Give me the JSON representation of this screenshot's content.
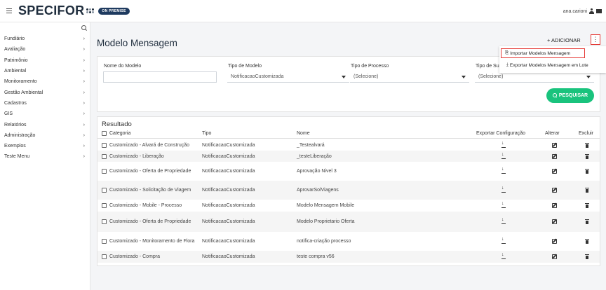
{
  "header": {
    "brand": "SPECIFOR",
    "badge": "ON PREMISE",
    "user": "ana.carioni"
  },
  "sidebar": {
    "items": [
      {
        "label": "Fundiário"
      },
      {
        "label": "Avaliação"
      },
      {
        "label": "Patrimônio"
      },
      {
        "label": "Ambiental"
      },
      {
        "label": "Monitoramento"
      },
      {
        "label": "Gestão Ambiental"
      },
      {
        "label": "Cadastros"
      },
      {
        "label": "GIS"
      },
      {
        "label": "Relatórios"
      },
      {
        "label": "Administração"
      },
      {
        "label": "Exemplos"
      },
      {
        "label": "Teste Menu"
      }
    ]
  },
  "page": {
    "title": "Modelo Mensagem",
    "add_label": "+ ADICIONAR",
    "kebab": "⋮"
  },
  "menu": {
    "import_label": "Importar Modelos Mensagem",
    "export_label": "Exportar Modelos Mensagem em Lote"
  },
  "filters": {
    "nome_label": "Nome do Modelo",
    "nome_value": "",
    "tipo_modelo_label": "Tipo de Modelo",
    "tipo_modelo_value": "NotificacaoCustomizada",
    "tipo_processo_label": "Tipo de Processo",
    "tipo_processo_value": "(Selecione)",
    "tipo_sub_label": "Tipo de Sub",
    "tipo_sub_value": "(Selecione)",
    "search_label": "PESQUISAR"
  },
  "results": {
    "title": "Resultado",
    "columns": {
      "categoria": "Categoria",
      "tipo": "Tipo",
      "nome": "Nome",
      "exportar": "Exportar Configuração",
      "alterar": "Alterar",
      "excluir": "Excluir"
    },
    "rows": [
      {
        "categoria": "Customizado - Alvará de Construção",
        "tipo": "NotificacaoCustomizada",
        "nome": "_Testealvará"
      },
      {
        "categoria": "Customizado - Liberação",
        "tipo": "NotificacaoCustomizada",
        "nome": "_testeLiberação"
      },
      {
        "categoria": "Customizado - Oferta de Propriedade",
        "tipo": "NotificacaoCustomizada",
        "nome": "Aprovação Nivel 3"
      },
      {
        "categoria": "Customizado - Solicitação de Viagem",
        "tipo": "NotificacaoCustomizada",
        "nome": "AprovarSolViagens"
      },
      {
        "categoria": "Customizado - Mobile - Processo",
        "tipo": "NotificacaoCustomizada",
        "nome": "Modelo Mensagem Mobile"
      },
      {
        "categoria": "Customizado - Oferta de Propriedade",
        "tipo": "NotificacaoCustomizada",
        "nome": "Modelo Proprietario Oferta"
      },
      {
        "categoria": "Customizado - Monitoramento de Flora",
        "tipo": "NotificacaoCustomizada",
        "nome": "notifica-criação processo"
      },
      {
        "categoria": "Customizado - Compra",
        "tipo": "NotificacaoCustomizada",
        "nome": "teste compra v56"
      }
    ]
  }
}
